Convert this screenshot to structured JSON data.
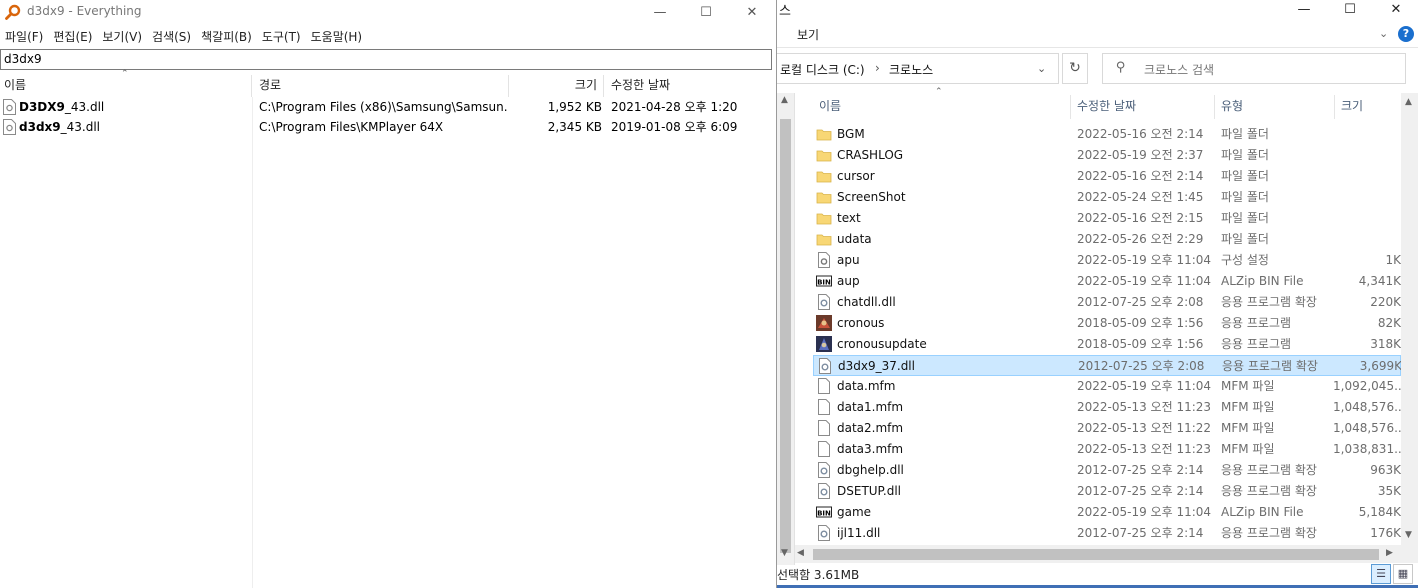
{
  "everything": {
    "title": "d3dx9 - Everything",
    "menu": [
      "파일(F)",
      "편집(E)",
      "보기(V)",
      "검색(S)",
      "책갈피(B)",
      "도구(T)",
      "도움말(H)"
    ],
    "search_value": "d3dx9",
    "columns": {
      "name": "이름",
      "path": "경로",
      "size": "크기",
      "date": "수정한 날짜"
    },
    "rows": [
      {
        "name_bold": "D3DX9",
        "name_rest": "_43.dll",
        "path": "C:\\Program Files (x86)\\Samsung\\Samsun...",
        "size": "1,952 KB",
        "date": "2021-04-28 오후 1:20"
      },
      {
        "name_bold": "d3dx9",
        "name_rest": "_43.dll",
        "path": "C:\\Program Files\\KMPlayer 64X",
        "size": "2,345 KB",
        "date": "2019-01-08 오후 6:09"
      }
    ]
  },
  "explorer": {
    "title_fragment": "스",
    "ribbon_tab": "보기",
    "address": {
      "drive": "로컬 디스크 (C:)",
      "folder": "크로노스"
    },
    "search_placeholder": "크로노스 검색",
    "columns": {
      "name": "이름",
      "date": "수정한 날짜",
      "type": "유형",
      "size": "크기"
    },
    "files": [
      {
        "name": "BGM",
        "date": "2022-05-16 오전 2:14",
        "type": "파일 폴더",
        "size": "",
        "icon": "folder-icon"
      },
      {
        "name": "CRASHLOG",
        "date": "2022-05-19 오전 2:37",
        "type": "파일 폴더",
        "size": "",
        "icon": "folder-icon"
      },
      {
        "name": "cursor",
        "date": "2022-05-16 오전 2:14",
        "type": "파일 폴더",
        "size": "",
        "icon": "folder-icon"
      },
      {
        "name": "ScreenShot",
        "date": "2022-05-24 오전 1:45",
        "type": "파일 폴더",
        "size": "",
        "icon": "folder-icon"
      },
      {
        "name": "text",
        "date": "2022-05-16 오전 2:15",
        "type": "파일 폴더",
        "size": "",
        "icon": "folder-icon"
      },
      {
        "name": "udata",
        "date": "2022-05-26 오전 2:29",
        "type": "파일 폴더",
        "size": "",
        "icon": "folder-icon"
      },
      {
        "name": "apu",
        "date": "2022-05-19 오후 11:04",
        "type": "구성 설정",
        "size": "1K",
        "icon": "config-file-icon"
      },
      {
        "name": "aup",
        "date": "2022-05-19 오후 11:04",
        "type": "ALZip BIN File",
        "size": "4,341K",
        "icon": "bin-file-icon"
      },
      {
        "name": "chatdll.dll",
        "date": "2012-07-25 오후 2:08",
        "type": "응용 프로그램 확장",
        "size": "220K",
        "icon": "dll-file-icon"
      },
      {
        "name": "cronous",
        "date": "2018-05-09 오후 1:56",
        "type": "응용 프로그램",
        "size": "82K",
        "icon": "app-icon"
      },
      {
        "name": "cronousupdate",
        "date": "2018-05-09 오후 1:56",
        "type": "응용 프로그램",
        "size": "318K",
        "icon": "updater-app-icon"
      },
      {
        "name": "d3dx9_37.dll",
        "date": "2012-07-25 오후 2:08",
        "type": "응용 프로그램 확장",
        "size": "3,699K",
        "icon": "dll-file-icon",
        "selected": true
      },
      {
        "name": "data.mfm",
        "date": "2022-05-19 오후 11:04",
        "type": "MFM 파일",
        "size": "1,092,045...",
        "icon": "blank-file-icon"
      },
      {
        "name": "data1.mfm",
        "date": "2022-05-13 오전 11:23",
        "type": "MFM 파일",
        "size": "1,048,576...",
        "icon": "blank-file-icon"
      },
      {
        "name": "data2.mfm",
        "date": "2022-05-13 오전 11:22",
        "type": "MFM 파일",
        "size": "1,048,576...",
        "icon": "blank-file-icon"
      },
      {
        "name": "data3.mfm",
        "date": "2022-05-13 오전 11:23",
        "type": "MFM 파일",
        "size": "1,038,831...",
        "icon": "blank-file-icon"
      },
      {
        "name": "dbghelp.dll",
        "date": "2012-07-25 오후 2:14",
        "type": "응용 프로그램 확장",
        "size": "963K",
        "icon": "dll-file-icon"
      },
      {
        "name": "DSETUP.dll",
        "date": "2012-07-25 오후 2:14",
        "type": "응용 프로그램 확장",
        "size": "35K",
        "icon": "dll-file-icon"
      },
      {
        "name": "game",
        "date": "2022-05-19 오후 11:04",
        "type": "ALZip BIN File",
        "size": "5,184K",
        "icon": "bin-file-icon"
      },
      {
        "name": "ijl11.dll",
        "date": "2012-07-25 오후 2:14",
        "type": "응용 프로그램 확장",
        "size": "176K",
        "icon": "dll-file-icon"
      }
    ],
    "status": "선택함 3.61MB",
    "colors": {
      "selection": "#cce8ff",
      "selection_border": "#99d1ff",
      "folder": "#f8d775",
      "help": "#1a6fce"
    }
  }
}
